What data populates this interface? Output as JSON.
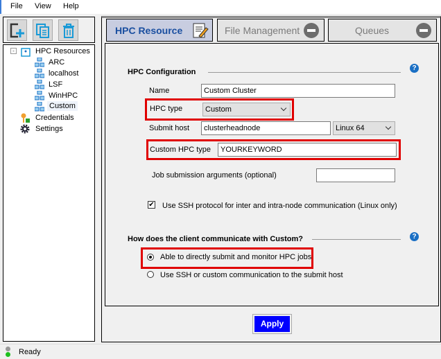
{
  "menu": {
    "file": "File",
    "view": "View",
    "help": "Help"
  },
  "tree": {
    "root": "HPC Resources",
    "children": [
      "ARC",
      "localhost",
      "LSF",
      "WinHPC",
      "Custom"
    ],
    "credentials": "Credentials",
    "settings": "Settings"
  },
  "tabs": {
    "hpc_resource": "HPC Resource",
    "file_management": "File Management",
    "queues": "Queues"
  },
  "config": {
    "section_title": "HPC Configuration",
    "name_label": "Name",
    "name_value": "Custom Cluster",
    "hpc_type_label": "HPC type",
    "hpc_type_value": "Custom",
    "submit_host_label": "Submit host",
    "submit_host_value": "clusterheadnode",
    "os_value": "Linux 64",
    "custom_type_label": "Custom HPC type",
    "custom_type_value": "YOURKEYWORD",
    "job_args_label": "Job submission arguments (optional)",
    "job_args_value": "",
    "ssh_checkbox_label": "Use SSH protocol for inter and intra-node communication (Linux only)",
    "ssh_checked": true
  },
  "comm": {
    "section_title": "How does the client communicate with Custom?",
    "option1": "Able to directly submit and monitor HPC jobs",
    "option2": "Use SSH or custom communication to the submit host",
    "selected": 1
  },
  "apply_label": "Apply",
  "help_glyph": "?",
  "status": "Ready",
  "colors": {
    "highlight": "#e00000",
    "apply": "#0000ff",
    "tab_active": "#c8cde0"
  }
}
